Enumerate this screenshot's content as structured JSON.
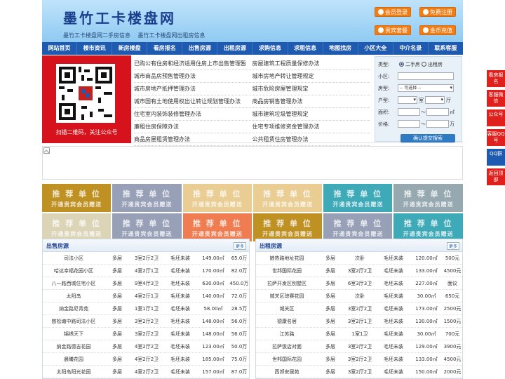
{
  "header": {
    "logo": "墨竹工卡楼盘网",
    "sub": [
      "墨竹工卡楼盘网二手房信息",
      "墨竹工卡楼盘网出租房信息"
    ],
    "buttons": {
      "login": "会员登录",
      "register": "免费注册",
      "package": "贵宾套餐",
      "recharge": "金币充值"
    }
  },
  "nav": [
    "网站首页",
    "楼市资讯",
    "新房楼盘",
    "看房报名",
    "出售房源",
    "出租房源",
    "求购信息",
    "求租信息",
    "地图找房",
    "小区大全",
    "中介名录",
    "联系客服"
  ],
  "qr": {
    "caption": "扫描二维码，关注公众号"
  },
  "links": [
    [
      "已购公有住房和经济适用住房上市出售管理暂",
      "房屋建筑工程质量保修办法"
    ],
    [
      "城市商品房预售管理办法",
      "城市房地产转让管理规定"
    ],
    [
      "城市房地产抵押管理办法",
      "城市危险房屋管理规定"
    ],
    [
      "城市国有土地使用权出让转让规划管理办法",
      "商品房销售管理办法"
    ],
    [
      "住宅室内装饰装修管理办法",
      "城市建筑垃圾管理规定"
    ],
    [
      "廉租住房保障办法",
      "住宅专项维修资金管理办法"
    ],
    [
      "商品房屋租赁管理办法",
      "公共租赁住房管理办法"
    ]
  ],
  "search": {
    "type_label": "类型:",
    "opt_sale": "二手房",
    "opt_rent": "出租房",
    "community_label": "小区:",
    "housetype_label": "房型:",
    "housetype_value": "-- 可选择 --",
    "layout_label": "户型:",
    "room_unit": "室",
    "hall_unit": "厅",
    "area_label": "面积:",
    "area_unit": "㎡",
    "price_label": "价格:",
    "price_unit": "万",
    "range_sep": "～",
    "submit": "确认提交搜索"
  },
  "units": {
    "title": "推 荐 单 位",
    "subtitle": "开通贵宾会员赠送",
    "colors": [
      "#b8860b",
      "#8c96b0",
      "#e8c888",
      "#e8c888",
      "#2aa0b0",
      "#8ca0a8",
      "#d8d0b0",
      "#8c96b0",
      "#ef7040",
      "#b8860b",
      "#8c96b0",
      "#2aa0b0"
    ]
  },
  "sale": {
    "title": "出售房源",
    "more": "更多",
    "rows": [
      [
        "司法小区",
        "多层",
        "3室2厅2卫",
        "毛坯未装",
        "149.00㎡",
        "65.0万"
      ],
      [
        "哈达幸福花园小区",
        "多层",
        "4室2厅1卫",
        "毛坯未装",
        "170.00㎡",
        "82.0万"
      ],
      [
        "八一路西城住宅小区",
        "多层",
        "9室4厅3卫",
        "毛坯未装",
        "630.00㎡",
        "450.0万"
      ],
      [
        "太阳岛",
        "多层",
        "4室2厅1卫",
        "毛坯未装",
        "140.00㎡",
        "72.0万"
      ],
      [
        "纳金路尼青苑",
        "多层",
        "1室1厅1卫",
        "毛坯未装",
        "58.00㎡",
        "28.5万"
      ],
      [
        "慈松塘中路司法小区",
        "多层",
        "3室2厅2卫",
        "毛坯未装",
        "148.00㎡",
        "56.0万"
      ],
      [
        "锦绣天下",
        "多层",
        "3室2厅2卫",
        "毛坯未装",
        "148.00㎡",
        "56.0万"
      ],
      [
        "纳金路德吉花园",
        "多层",
        "4室2厅2卫",
        "毛坯未装",
        "123.00㎡",
        "50.0万"
      ],
      [
        "晨曦花园",
        "多层",
        "4室2厅2卫",
        "毛坯未装",
        "185.00㎡",
        "75.0万"
      ],
      [
        "太阳岛阳光花园",
        "多层",
        "4室2厅2卫",
        "毛坯未装",
        "157.00㎡",
        "87.0万"
      ]
    ]
  },
  "rent": {
    "title": "出租房源",
    "more": "更多",
    "rows": [
      [
        "娘热路地址花园",
        "多层",
        "次卧",
        "毛坯未装",
        "120.00㎡",
        "500元"
      ],
      [
        "世邦国际花园",
        "多层",
        "3室2厅2卫",
        "毛坯未装",
        "133.00㎡",
        "4500元"
      ],
      [
        "拉萨开发区别墅区",
        "多层",
        "6室3厅3卫",
        "毛坯未装",
        "227.00㎡",
        "面议"
      ],
      [
        "城关区琼赛花园",
        "多层",
        "次卧",
        "毛坯未装",
        "30.00㎡",
        "650元"
      ],
      [
        "城关区",
        "多层",
        "3室2厅2卫",
        "毛坯未装",
        "173.00㎡",
        "2500元"
      ],
      [
        "德康名居",
        "多层",
        "3室2厅1卫",
        "毛坯未装",
        "130.00㎡",
        "1500元"
      ],
      [
        "江苏路",
        "多层",
        "1室1卫",
        "毛坯未装",
        "30.00㎡",
        "700元"
      ],
      [
        "拉萨饭店对面",
        "多层",
        "3室2厅2卫",
        "毛坯未装",
        "129.00㎡",
        "3900元"
      ],
      [
        "世邦国际花园",
        "多层",
        "3室2厅2卫",
        "毛坯未装",
        "133.00㎡",
        "4500元"
      ],
      [
        "西郊安居苑",
        "多层",
        "3室2厅2卫",
        "毛坯未装",
        "150.00㎡",
        "2000元"
      ]
    ]
  },
  "side": [
    "看房报名",
    "客服微信",
    "公众号",
    "客服QQ号",
    "QQ群",
    "返回顶部"
  ]
}
